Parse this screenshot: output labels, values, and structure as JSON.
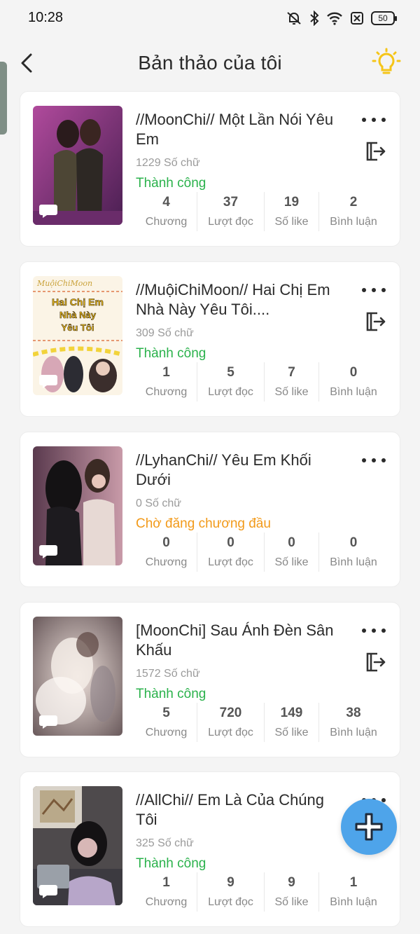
{
  "status_bar": {
    "time": "10:28",
    "battery": "50"
  },
  "header": {
    "title": "Bản thảo của tôi"
  },
  "stat_labels": {
    "chapters": "Chương",
    "reads": "Lượt đọc",
    "likes": "Số like",
    "comments": "Bình luận"
  },
  "stories": [
    {
      "title": "//MoonChi// Một Lần Nói Yêu Em",
      "words": "1229 Số chữ",
      "status": "Thành công",
      "status_type": "ok",
      "chapters": "4",
      "reads": "37",
      "likes": "19",
      "comments": "2",
      "has_export": true
    },
    {
      "title": "//MuộiChiMoon// Hai Chị Em Nhà Này Yêu Tôi....",
      "words": "309 Số chữ",
      "status": "Thành công",
      "status_type": "ok",
      "chapters": "1",
      "reads": "5",
      "likes": "7",
      "comments": "0",
      "has_export": true,
      "cover_text": {
        "top": "MuộiChiMoon",
        "line1": "Hai Chị Em",
        "line2": "Nhà Này",
        "line3": "Yêu Tôi"
      }
    },
    {
      "title": "//LyhanChi// Yêu Em Khối Dưới",
      "words": "0 Số chữ",
      "status": "Chờ đăng chương đầu",
      "status_type": "wait",
      "chapters": "0",
      "reads": "0",
      "likes": "0",
      "comments": "0",
      "has_export": false
    },
    {
      "title": "[MoonChi] Sau Ánh Đèn Sân Khấu",
      "words": "1572 Số chữ",
      "status": "Thành công",
      "status_type": "ok",
      "chapters": "5",
      "reads": "720",
      "likes": "149",
      "comments": "38",
      "has_export": true
    },
    {
      "title": "//AllChi// Em Là Của Chúng Tôi",
      "words": "325 Số chữ",
      "status": "Thành công",
      "status_type": "ok",
      "chapters": "1",
      "reads": "9",
      "likes": "9",
      "comments": "1",
      "has_export": false
    }
  ],
  "colors": {
    "success": "#2bb24c",
    "pending": "#f29a1a",
    "fab": "#4ea4ea",
    "bulb": "#f5c518"
  },
  "icons": {
    "back": "chevron-left-icon",
    "bulb": "lightbulb-icon",
    "more": "more-horizontal-icon",
    "export": "export-icon",
    "comment": "comment-bubble-icon",
    "fab": "plus-icon"
  }
}
